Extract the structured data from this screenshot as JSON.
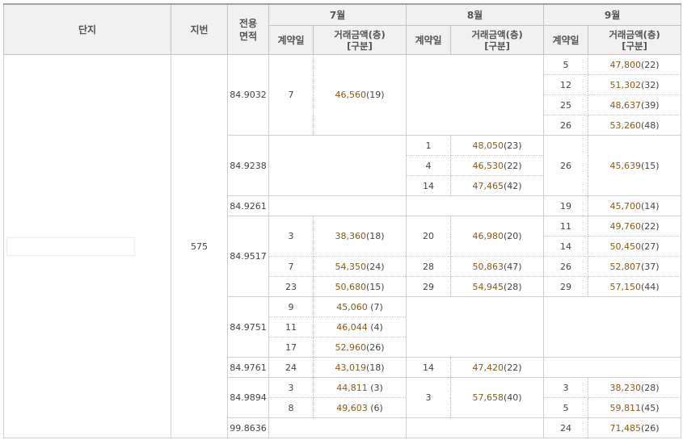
{
  "header": {
    "danji": "단지",
    "jibun": "지번",
    "area_line1": "전용",
    "area_line2": "면적",
    "months": [
      "7월",
      "8월",
      "9월"
    ],
    "day_label": "계약일",
    "price_label_line1": "거래금액(층)",
    "price_label_line2": "[구분]"
  },
  "complex": {
    "name": "",
    "jibun": "575"
  },
  "rows": {
    "r1": {
      "area": "84.9032",
      "jul_day": "7",
      "jul_amt": "46,560",
      "jul_fl": "(19)",
      "sep": [
        {
          "day": "5",
          "amt": "47,800",
          "fl": "(22)"
        },
        {
          "day": "12",
          "amt": "51,302",
          "fl": "(32)"
        },
        {
          "day": "25",
          "amt": "48,637",
          "fl": "(39)"
        },
        {
          "day": "26",
          "amt": "53,260",
          "fl": "(48)"
        }
      ]
    },
    "r2": {
      "area": "84.9238",
      "aug": [
        {
          "day": "1",
          "amt": "48,050",
          "fl": "(23)"
        },
        {
          "day": "4",
          "amt": "46,530",
          "fl": "(22)"
        },
        {
          "day": "14",
          "amt": "47,465",
          "fl": "(42)"
        }
      ],
      "sep_day": "26",
      "sep_amt": "45,639",
      "sep_fl": "(15)"
    },
    "r3": {
      "area": "84.9261",
      "sep_day": "19",
      "sep_amt": "45,700",
      "sep_fl": "(14)"
    },
    "r4": {
      "area": "84.9517",
      "jul": [
        {
          "day": "3",
          "amt": "38,360",
          "fl": "(18)"
        },
        {
          "day": "7",
          "amt": "54,350",
          "fl": "(24)"
        },
        {
          "day": "23",
          "amt": "50,680",
          "fl": "(15)"
        }
      ],
      "aug": [
        {
          "day": "20",
          "amt": "46,980",
          "fl": "(20)"
        },
        {
          "day": "28",
          "amt": "50,863",
          "fl": "(47)"
        },
        {
          "day": "29",
          "amt": "54,945",
          "fl": "(28)"
        }
      ],
      "sep": [
        {
          "day": "11",
          "amt": "49,760",
          "fl": "(22)"
        },
        {
          "day": "14",
          "amt": "50,450",
          "fl": "(27)"
        },
        {
          "day": "26",
          "amt": "52,807",
          "fl": "(37)"
        },
        {
          "day": "29",
          "amt": "57,150",
          "fl": "(44)"
        }
      ]
    },
    "r5": {
      "area": "84.9751",
      "jul": [
        {
          "day": "9",
          "amt": "45,060",
          "fl": " (7)"
        },
        {
          "day": "11",
          "amt": "46,044",
          "fl": " (4)"
        },
        {
          "day": "17",
          "amt": "52,960",
          "fl": "(26)"
        }
      ]
    },
    "r6": {
      "area": "84.9761",
      "jul_day": "24",
      "jul_amt": "43,019",
      "jul_fl": "(18)",
      "aug_day": "14",
      "aug_amt": "47,420",
      "aug_fl": "(22)"
    },
    "r7": {
      "area": "84.9894",
      "jul": [
        {
          "day": "3",
          "amt": "44,811",
          "fl": " (3)"
        },
        {
          "day": "8",
          "amt": "49,603",
          "fl": " (6)"
        }
      ],
      "aug_day": "3",
      "aug_amt": "57,658",
      "aug_fl": "(40)",
      "sep": [
        {
          "day": "3",
          "amt": "38,230",
          "fl": "(28)"
        },
        {
          "day": "5",
          "amt": "59,811",
          "fl": "(45)"
        }
      ]
    },
    "r8": {
      "area": "99.8636",
      "sep_day": "24",
      "sep_amt": "71,485",
      "sep_fl": "(26)"
    }
  },
  "colors": {
    "header_bg": "#f1f1f1",
    "price": "#8a5a14",
    "border": "#cfcfcf"
  }
}
